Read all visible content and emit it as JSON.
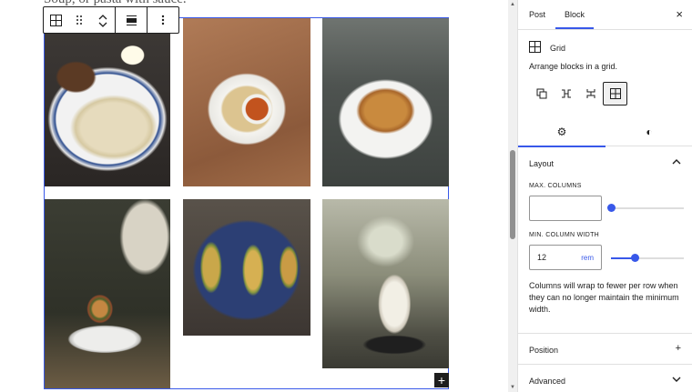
{
  "canvas": {
    "top_text": "Soup, or pasta with sauce."
  },
  "toolbar": {
    "block_type_icon": "grid-icon",
    "drag_icon": "drag-handle-icon",
    "move_up_icon": "chevron-up-icon",
    "move_down_icon": "chevron-down-icon",
    "align_icon": "justify-icon",
    "more_icon": "more-vertical-icon"
  },
  "grid_images": [
    {
      "name": "noodles-with-egg-image"
    },
    {
      "name": "momos-image"
    },
    {
      "name": "fried-noodles-image"
    },
    {
      "name": "burger-image"
    },
    {
      "name": "tacos-image"
    },
    {
      "name": "drink-image"
    }
  ],
  "add_block": {
    "label": "+"
  },
  "sidebar": {
    "tabs": [
      {
        "label": "Post"
      },
      {
        "label": "Block"
      }
    ],
    "close": "×",
    "block": {
      "title": "Grid",
      "description": "Arrange blocks in a grid."
    },
    "settings_tabs": [
      {
        "icon": "gear-icon",
        "glyph": "⚙"
      },
      {
        "icon": "styles-icon",
        "glyph": "◐"
      }
    ],
    "layout": {
      "title": "Layout",
      "toggle": "⌃",
      "max_columns_label": "MAX. COLUMNS",
      "max_columns_value": "",
      "max_columns_slider_fraction": 0.0,
      "min_width_label": "MIN. COLUMN WIDTH",
      "min_width_value": "12",
      "min_width_unit": "rem",
      "min_width_slider_fraction": 0.32,
      "help": "Columns will wrap to fewer per row when they can no longer maintain the minimum width."
    },
    "position": {
      "title": "Position",
      "toggle": "+"
    },
    "advanced": {
      "title": "Advanced",
      "toggle": "⌄"
    }
  },
  "colors": {
    "accent": "#3858e9",
    "text": "#1e1e1e",
    "border": "#e0e0e0"
  }
}
